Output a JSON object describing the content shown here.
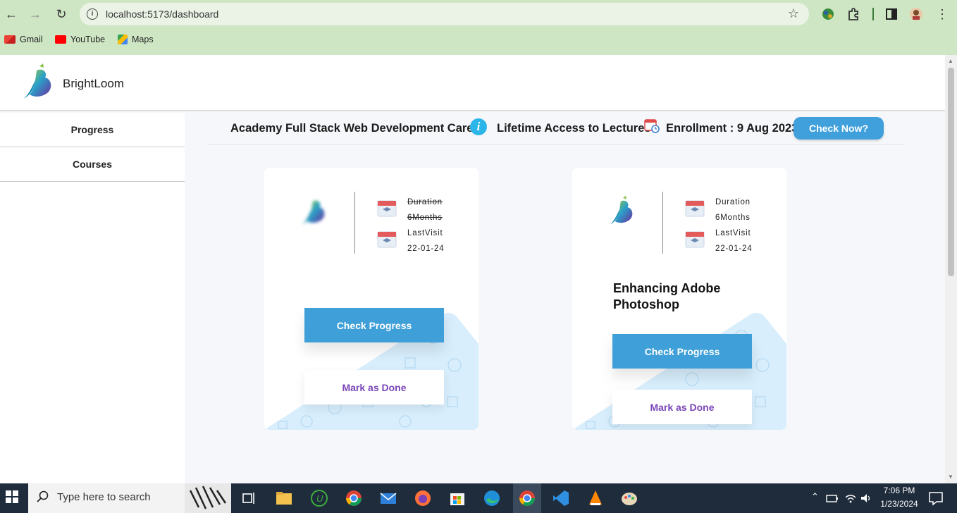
{
  "browser": {
    "url": "localhost:5173/dashboard",
    "bookmarks": [
      {
        "label": "Gmail",
        "icon": "gmail-icon"
      },
      {
        "label": "YouTube",
        "icon": "youtube-icon"
      },
      {
        "label": "Maps",
        "icon": "maps-icon"
      }
    ]
  },
  "app": {
    "brand": "BrightLoom"
  },
  "sidebar": {
    "items": [
      {
        "label": "Progress"
      },
      {
        "label": "Courses"
      }
    ]
  },
  "infobar": {
    "course_title": "Academy Full Stack Web Development Career",
    "info_icon": "i",
    "access": "Lifetime Access to Lectures",
    "enrollment": "Enrollment : 9 Aug 2023",
    "check_now": "Check Now?"
  },
  "cards": [
    {
      "duration_label": "Duration",
      "duration_value": "6Months",
      "last_visit_label": "LastVisit",
      "last_visit_value": "22-01-24",
      "title": "",
      "progress_button": "Check Progress",
      "done_button": "Mark as Done"
    },
    {
      "duration_label": "Duration",
      "duration_value": "6Months",
      "last_visit_label": "LastVisit",
      "last_visit_value": "22-01-24",
      "title": "Enhancing Adobe Photoshop",
      "progress_button": "Check Progress",
      "done_button": "Mark as Done"
    }
  ],
  "taskbar": {
    "search_placeholder": "Type here to search",
    "time": "7:06 PM",
    "date": "1/23/2024"
  },
  "colors": {
    "chrome_bg": "#cfe6c4",
    "accent_blue": "#3f9fd8",
    "done_purple": "#7a47b8",
    "taskbar_bg": "#1f2c3c"
  }
}
